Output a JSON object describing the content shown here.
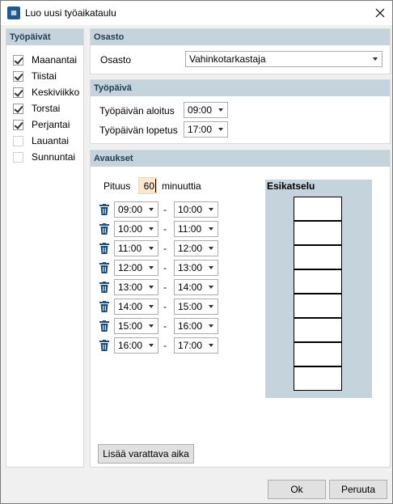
{
  "window": {
    "title": "Luo uusi työaikataulu",
    "icon": "calendar-app-icon"
  },
  "workdays": {
    "header": "Työpäivät",
    "days": [
      {
        "label": "Maanantai",
        "checked": true
      },
      {
        "label": "Tiistai",
        "checked": true
      },
      {
        "label": "Keskiviikko",
        "checked": true
      },
      {
        "label": "Torstai",
        "checked": true
      },
      {
        "label": "Perjantai",
        "checked": true
      },
      {
        "label": "Lauantai",
        "checked": false
      },
      {
        "label": "Sunnuntai",
        "checked": false
      }
    ]
  },
  "osasto": {
    "header": "Osasto",
    "label": "Osasto",
    "value": "Vahinkotarkastaja"
  },
  "tyopaiva": {
    "header": "Työpäivä",
    "start_label": "Työpäivän aloitus",
    "start_value": "09:00",
    "end_label": "Työpäivän lopetus",
    "end_value": "17:00"
  },
  "avaukset": {
    "header": "Avaukset",
    "length_label": "Pituus",
    "length_value": "60",
    "length_unit": "minuuttia",
    "separator": "-",
    "slots": [
      {
        "start": "09:00",
        "end": "10:00"
      },
      {
        "start": "10:00",
        "end": "11:00"
      },
      {
        "start": "11:00",
        "end": "12:00"
      },
      {
        "start": "12:00",
        "end": "13:00"
      },
      {
        "start": "13:00",
        "end": "14:00"
      },
      {
        "start": "14:00",
        "end": "15:00"
      },
      {
        "start": "15:00",
        "end": "16:00"
      },
      {
        "start": "16:00",
        "end": "17:00"
      }
    ],
    "add_button": "Lisää varattava aika",
    "preview_title": "Esikatselu",
    "preview_slot_count": 8
  },
  "footer": {
    "ok": "Ok",
    "cancel": "Peruuta"
  },
  "colors": {
    "panel_header": "#c5d3dc",
    "header_text": "#243e52",
    "length_input_bg": "#fde7d2"
  }
}
